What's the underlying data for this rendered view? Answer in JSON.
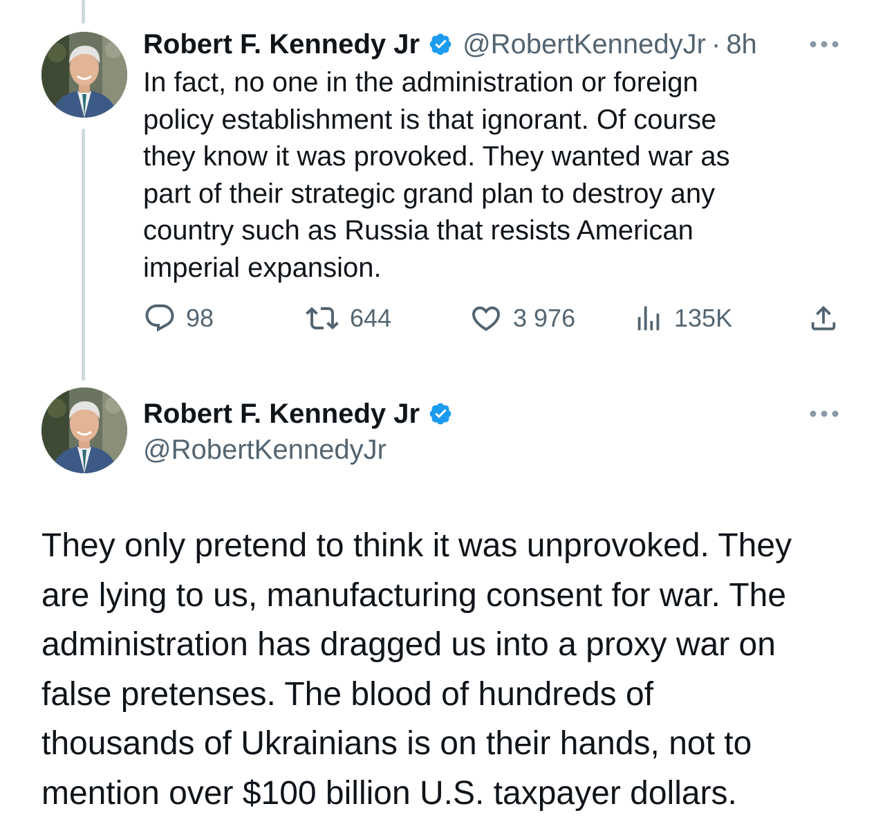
{
  "thread": {
    "reply_tweet": {
      "author": {
        "display_name": "Robert F. Kennedy Jr",
        "verified": true,
        "handle": "@RobertKennedyJr"
      },
      "separator": "·",
      "timestamp": "8h",
      "text": "In fact, no one in the administration or foreign\npolicy establishment is that ignorant. Of course\nthey know it was provoked. They wanted war as\npart of their strategic grand plan to destroy any\ncountry such as Russia that resists American\nimperial expansion.",
      "stats": {
        "replies": "98",
        "retweets": "644",
        "likes": "3 976",
        "views": "135K"
      }
    },
    "main_tweet": {
      "author": {
        "display_name": "Robert F. Kennedy Jr",
        "verified": true,
        "handle": "@RobertKennedyJr"
      },
      "text": "They only pretend to think it was unprovoked. They\nare lying to us, manufacturing consent for war. The\nadministration has dragged us into a proxy war on\nfalse pretenses. The blood of hundreds of\nthousands of Ukrainians is on their hands, not to\nmention over $100 billion U.S. taxpayer dollars."
    }
  },
  "icons": {
    "reply": "speech-bubble-icon",
    "retweet": "retweet-arrows-icon",
    "like": "heart-icon",
    "views": "bar-chart-icon",
    "share": "share-upload-icon",
    "more": "three-dots-icon",
    "verified": "verified-badge-icon"
  },
  "colors": {
    "text_primary": "#0f1419",
    "text_secondary": "#536471",
    "verified_blue": "#1d9bf0",
    "thread_line": "#cfd9de",
    "background": "#ffffff"
  }
}
